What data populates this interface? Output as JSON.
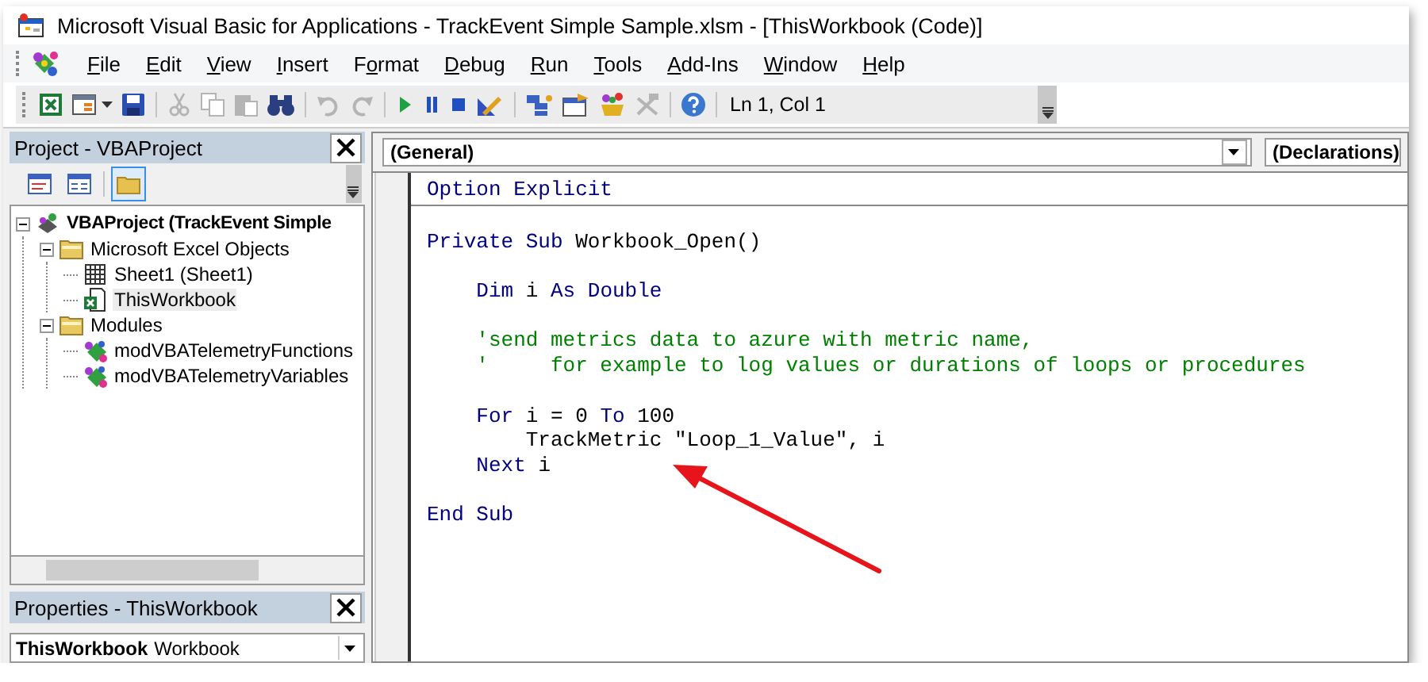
{
  "window": {
    "title": "Microsoft Visual Basic for Applications - TrackEvent Simple Sample.xlsm - [ThisWorkbook (Code)]"
  },
  "menu": [
    {
      "key": "F",
      "post": "ile"
    },
    {
      "key": "E",
      "post": "dit"
    },
    {
      "key": "V",
      "post": "iew"
    },
    {
      "key": "I",
      "post": "nsert"
    },
    {
      "pre": "F",
      "key": "o",
      "post": "rmat"
    },
    {
      "key": "D",
      "post": "ebug"
    },
    {
      "key": "R",
      "post": "un"
    },
    {
      "key": "T",
      "post": "ools"
    },
    {
      "key": "A",
      "post": "dd-Ins"
    },
    {
      "key": "W",
      "post": "indow"
    },
    {
      "key": "H",
      "post": "elp"
    }
  ],
  "toolbar": {
    "buttons": [
      {
        "kind": "excel",
        "disabled": false
      },
      {
        "kind": "form",
        "disabled": false
      },
      {
        "kind": "save",
        "disabled": false
      },
      {
        "kind": "sep"
      },
      {
        "kind": "cut",
        "disabled": true
      },
      {
        "kind": "copy",
        "disabled": true
      },
      {
        "kind": "paste",
        "disabled": true
      },
      {
        "kind": "find",
        "disabled": false
      },
      {
        "kind": "sep"
      },
      {
        "kind": "undo",
        "disabled": true
      },
      {
        "kind": "redo",
        "disabled": true
      },
      {
        "kind": "sep"
      },
      {
        "kind": "run",
        "disabled": false
      },
      {
        "kind": "pause",
        "disabled": false
      },
      {
        "kind": "stop",
        "disabled": false
      },
      {
        "kind": "design",
        "disabled": false
      },
      {
        "kind": "sep"
      },
      {
        "kind": "project",
        "disabled": false
      },
      {
        "kind": "properties",
        "disabled": false
      },
      {
        "kind": "browser",
        "disabled": false
      },
      {
        "kind": "toolbox",
        "disabled": true
      },
      {
        "kind": "sep"
      },
      {
        "kind": "help",
        "disabled": false
      },
      {
        "kind": "sep"
      }
    ],
    "position": "Ln 1, Col 1"
  },
  "project_pane": {
    "title": "Project - VBAProject",
    "buttons": [
      {
        "kind": "code",
        "pressed": false
      },
      {
        "kind": "object",
        "pressed": false
      },
      {
        "kind": "folders",
        "pressed": true
      }
    ],
    "tree": [
      {
        "label": "VBAProject (TrackEvent Simple",
        "kind": "project",
        "expanded": true,
        "selected": false,
        "children": [
          {
            "label": "Microsoft Excel Objects",
            "kind": "folder",
            "expanded": true,
            "selected": false,
            "children": [
              {
                "label": "Sheet1 (Sheet1)",
                "kind": "sheet",
                "selected": false
              },
              {
                "label": "ThisWorkbook",
                "kind": "workbook",
                "selected": true
              }
            ]
          },
          {
            "label": "Modules",
            "kind": "folder",
            "expanded": true,
            "selected": false,
            "children": [
              {
                "label": "modVBATelemetryFunctions",
                "kind": "module",
                "selected": false
              },
              {
                "label": "modVBATelemetryVariables",
                "kind": "module",
                "selected": false
              }
            ]
          }
        ]
      }
    ]
  },
  "properties_pane": {
    "title": "Properties - ThisWorkbook",
    "object_name": "ThisWorkbook",
    "object_type": "Workbook"
  },
  "code_pane": {
    "object_combo": "(General)",
    "procedure_combo": "(Declarations)",
    "sections": [
      {
        "paragraphs": [
          {
            "lines": [
              {
                "segments": [
                  {
                    "kind": "keyword",
                    "text": "Option Explicit"
                  }
                ]
              }
            ]
          }
        ]
      },
      {
        "paragraphs": [
          {
            "lines": [
              {
                "segments": [
                  {
                    "kind": "keyword",
                    "text": "Private Sub"
                  },
                  {
                    "kind": "plain",
                    "text": " Workbook_Open()"
                  }
                ]
              }
            ]
          },
          {
            "lines": [
              {
                "segments": [
                  {
                    "kind": "keyword",
                    "text": "    Dim"
                  },
                  {
                    "kind": "plain",
                    "text": " i "
                  },
                  {
                    "kind": "keyword",
                    "text": "As Double"
                  }
                ]
              }
            ]
          },
          {
            "lines": [
              {
                "segments": [
                  {
                    "kind": "comment",
                    "text": "    'send metrics data to azure with metric name,"
                  }
                ]
              },
              {
                "segments": [
                  {
                    "kind": "comment",
                    "text": "    '     for example to log values or durations of loops or procedures"
                  }
                ]
              }
            ]
          },
          {
            "lines": [
              {
                "segments": [
                  {
                    "kind": "keyword",
                    "text": "    For"
                  },
                  {
                    "kind": "plain",
                    "text": " i = 0 "
                  },
                  {
                    "kind": "keyword",
                    "text": "To"
                  },
                  {
                    "kind": "plain",
                    "text": " 100"
                  }
                ]
              },
              {
                "segments": [
                  {
                    "kind": "plain",
                    "text": "        TrackMetric \"Loop_1_Value\", i"
                  }
                ]
              },
              {
                "segments": [
                  {
                    "kind": "keyword",
                    "text": "    Next"
                  },
                  {
                    "kind": "plain",
                    "text": " i"
                  }
                ]
              }
            ]
          },
          {
            "lines": [
              {
                "segments": [
                  {
                    "kind": "keyword",
                    "text": "End Sub"
                  }
                ]
              }
            ]
          }
        ]
      }
    ]
  }
}
